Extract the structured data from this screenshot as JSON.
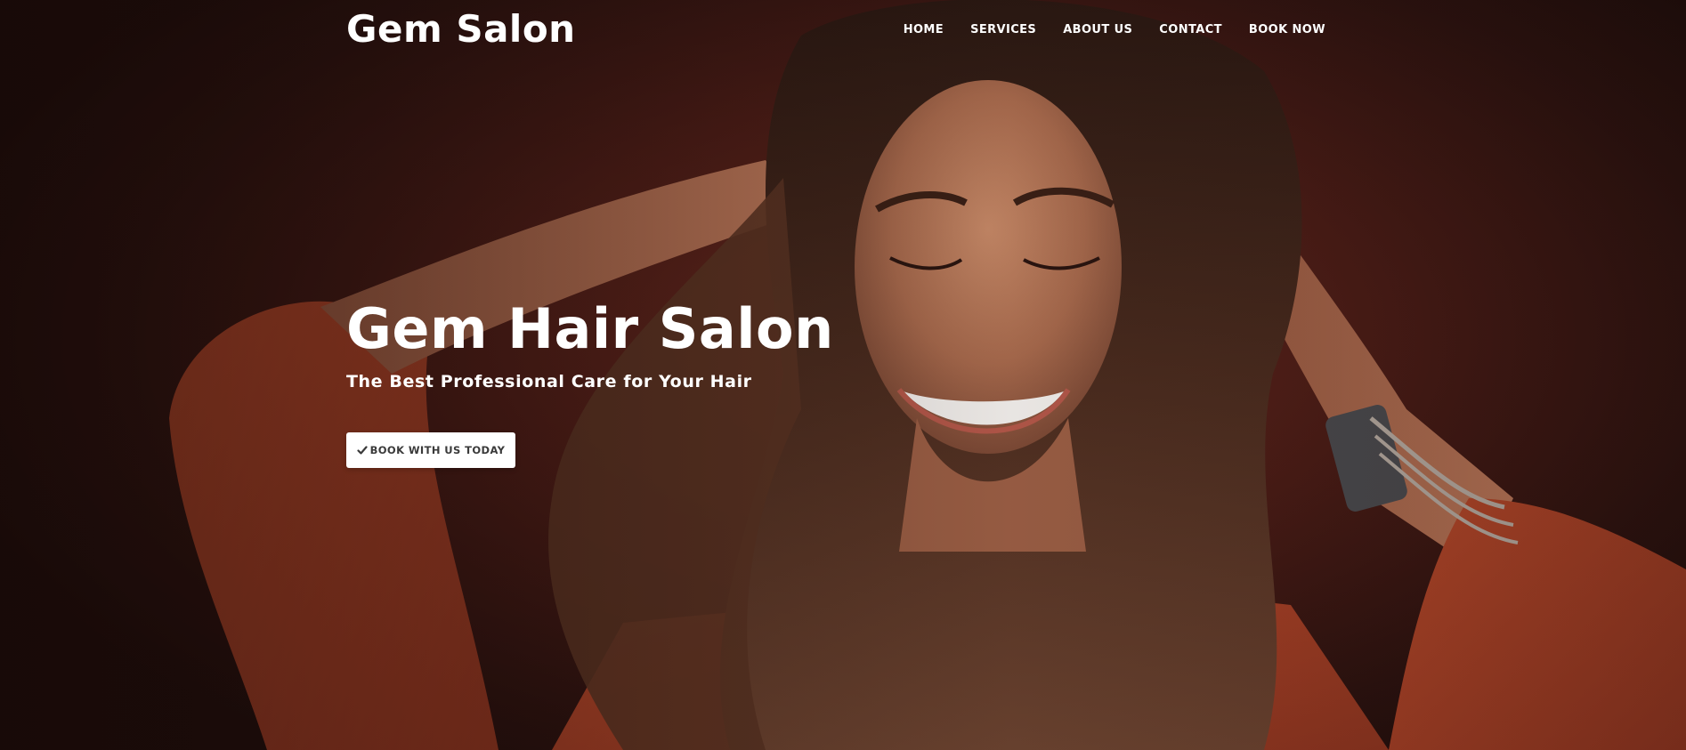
{
  "header": {
    "brand": "Gem Salon",
    "nav": [
      {
        "label": "HOME"
      },
      {
        "label": "SERVICES"
      },
      {
        "label": "ABOUT US"
      },
      {
        "label": "CONTACT"
      },
      {
        "label": "BOOK NOW"
      }
    ]
  },
  "hero": {
    "title": "Gem Hair Salon",
    "subtitle": "The Best Professional Care for Your Hair",
    "cta_label": "BOOK WITH US TODAY",
    "cta_icon": "check-icon",
    "background_image": "woman-smiling-hands-in-hair-photo"
  },
  "colors": {
    "background": "#4a1c16",
    "sweater": "#b5482a",
    "text": "#ffffff",
    "button_bg": "#ffffff",
    "button_text": "#3a3a3a"
  }
}
